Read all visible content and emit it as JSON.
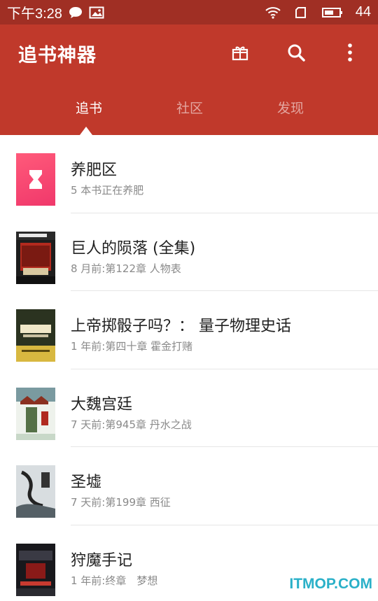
{
  "status_bar": {
    "time": "下午3:28",
    "battery_level": "44",
    "icons": [
      "chat-bubble-icon",
      "image-icon",
      "wifi-icon",
      "sim-icon",
      "battery-icon"
    ]
  },
  "app_bar": {
    "title": "追书神器",
    "actions": [
      "gift-icon",
      "search-icon",
      "more-icon"
    ],
    "background_color": "#c0392b"
  },
  "tabs": [
    {
      "label": "追书",
      "active": true
    },
    {
      "label": "社区",
      "active": false
    },
    {
      "label": "发现",
      "active": false
    }
  ],
  "books": [
    {
      "title": "养肥区",
      "subtitle": "5 本书正在养肥",
      "cover": "hourglass-icon"
    },
    {
      "title": "巨人的陨落 (全集)",
      "subtitle": "8 月前:第122章 人物表",
      "cover": "book-cover-giants"
    },
    {
      "title": "上帝掷骰子吗？： 量子物理史话",
      "subtitle": "1 年前:第四十章 霍金打赌",
      "cover": "book-cover-quantum"
    },
    {
      "title": "大魏宫廷",
      "subtitle": "7 天前:第945章 丹水之战",
      "cover": "book-cover-wei"
    },
    {
      "title": "圣墟",
      "subtitle": "7 天前:第199章 西征",
      "cover": "book-cover-shengxu"
    },
    {
      "title": "狩魔手记",
      "subtitle": "1 年前:终章　梦想",
      "cover": "book-cover-demon"
    }
  ],
  "watermark": "ITMOP.COM"
}
